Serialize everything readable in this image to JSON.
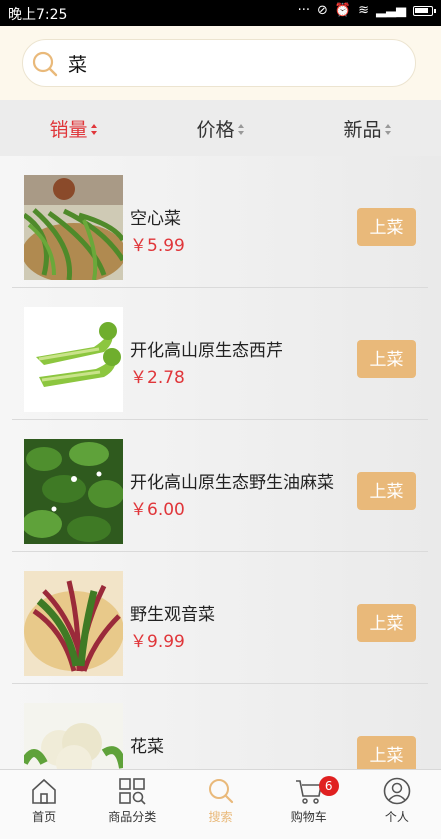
{
  "status_bar": {
    "time": "晚上7:25"
  },
  "search": {
    "query": "菜"
  },
  "sort_tabs": [
    {
      "label": "销量",
      "active": true
    },
    {
      "label": "价格",
      "active": false
    },
    {
      "label": "新品",
      "active": false
    }
  ],
  "products": [
    {
      "name": "空心菜",
      "price": "￥5.99",
      "button": "上菜"
    },
    {
      "name": "开化高山原生态西芹",
      "price": "￥2.78",
      "button": "上菜"
    },
    {
      "name": "开化高山原生态野生油麻菜",
      "price": "￥6.00",
      "button": "上菜"
    },
    {
      "name": "野生观音菜",
      "price": "￥9.99",
      "button": "上菜"
    },
    {
      "name": "花菜",
      "price": "",
      "button": "上菜"
    }
  ],
  "tabbar": [
    {
      "label": "首页",
      "icon": "home-icon"
    },
    {
      "label": "商品分类",
      "icon": "category-icon"
    },
    {
      "label": "搜索",
      "icon": "search-icon",
      "active": true
    },
    {
      "label": "购物车",
      "icon": "cart-icon",
      "badge": "6"
    },
    {
      "label": "个人",
      "icon": "user-icon"
    }
  ],
  "colors": {
    "accent": "#e9b97a",
    "price_red": "#e0363a",
    "badge_red": "#e02020"
  }
}
